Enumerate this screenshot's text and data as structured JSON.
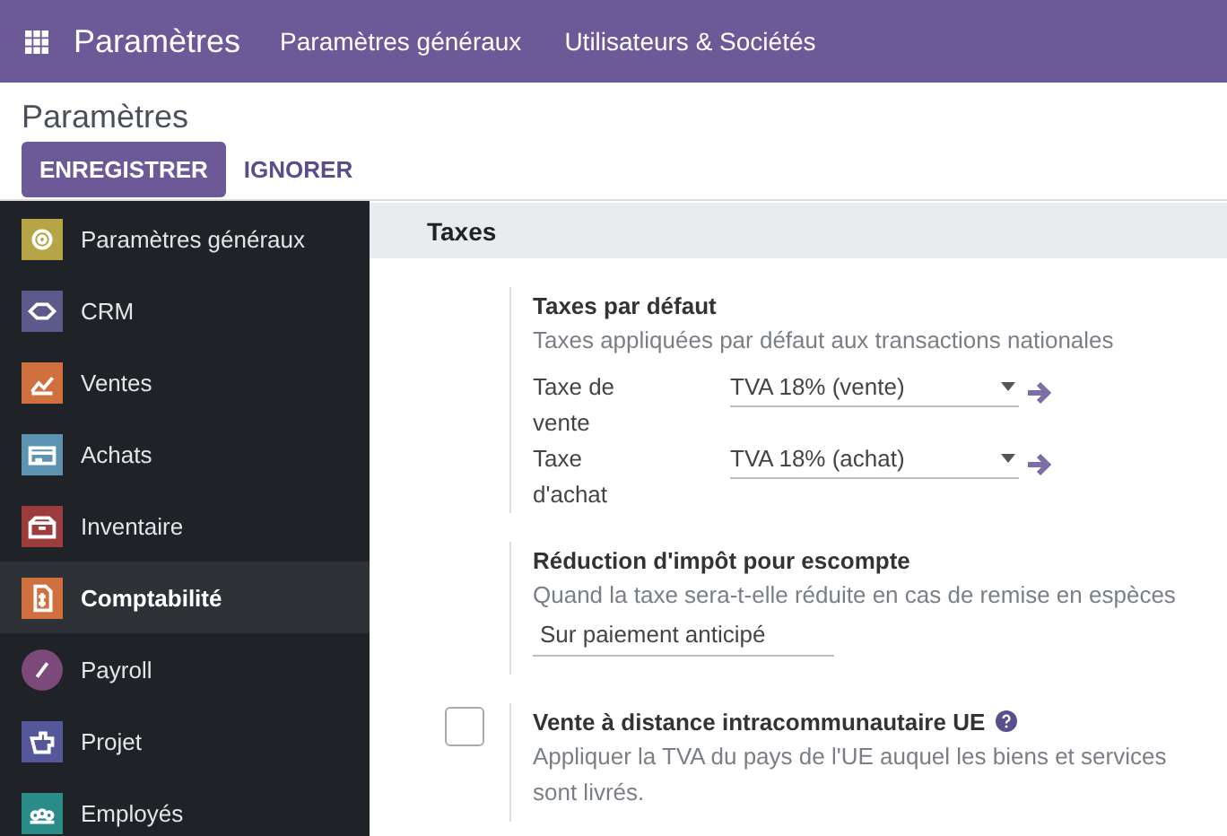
{
  "navbar": {
    "app_title": "Paramètres",
    "menu": [
      "Paramètres généraux",
      "Utilisateurs & Sociétés"
    ]
  },
  "control_panel": {
    "breadcrumb": "Paramètres",
    "buttons": [
      {
        "label": "ENREGISTRER",
        "kind": "primary"
      },
      {
        "label": "IGNORER",
        "kind": "link"
      }
    ]
  },
  "sidebar": {
    "items": [
      {
        "label": "Paramètres généraux",
        "color": "#b5a546",
        "selected": false
      },
      {
        "label": "CRM",
        "color": "#5b5a8a",
        "selected": false
      },
      {
        "label": "Ventes",
        "color": "#d0703f",
        "selected": false
      },
      {
        "label": "Achats",
        "color": "#5d93b0",
        "selected": false
      },
      {
        "label": "Inventaire",
        "color": "#9c3c3c",
        "selected": false
      },
      {
        "label": "Comptabilité",
        "color": "#d0703f",
        "selected": true
      },
      {
        "label": "Payroll",
        "color": "#7c4a7a",
        "selected": false
      },
      {
        "label": "Projet",
        "color": "#55579a",
        "selected": false
      },
      {
        "label": "Employés",
        "color": "#2a8c88",
        "selected": false
      }
    ]
  },
  "section": {
    "title": "Taxes",
    "settings": [
      {
        "kind": "fields",
        "title": "Taxes par défaut",
        "description": "Taxes appliquées par défaut aux transactions nationales",
        "fields": [
          {
            "label": "Taxe de vente",
            "value": "TVA 18% (vente)"
          },
          {
            "label": "Taxe d'achat",
            "value": "TVA 18% (achat)"
          }
        ]
      },
      {
        "kind": "select",
        "title": "Réduction d'impôt pour escompte",
        "description": "Quand la taxe sera-t-elle réduite en cas de remise en espèces",
        "value": "Sur paiement anticipé"
      },
      {
        "kind": "checkbox",
        "checked": false,
        "help": true,
        "title": "Vente à distance intracommunautaire UE",
        "description": "Appliquer la TVA du pays de l'UE auquel les biens et services sont livrés."
      }
    ]
  }
}
